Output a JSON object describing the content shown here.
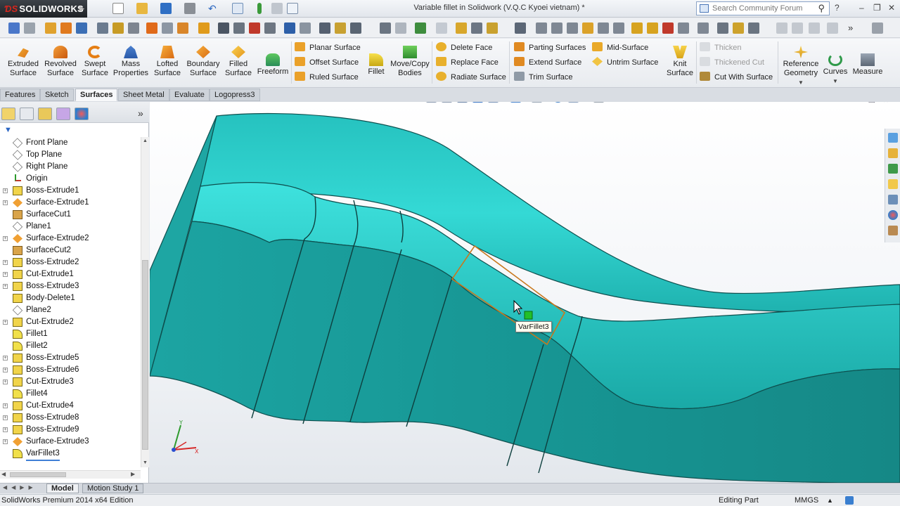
{
  "app": {
    "brand": "SOLIDWORKS",
    "window_title": "Variable fillet in Solidwork (V.Q.C Kyoei vietnam) *"
  },
  "search": {
    "placeholder": "Search Community Forum"
  },
  "ribbon": {
    "extruded_surface": "Extruded Surface",
    "revolved_surface": "Revolved Surface",
    "swept_surface": "Swept Surface",
    "mass_properties": "Mass Properties",
    "lofted_surface": "Lofted Surface",
    "boundary_surface": "Boundary Surface",
    "filled_surface": "Filled Surface",
    "freeform": "Freeform",
    "planar_surface": "Planar Surface",
    "offset_surface": "Offset Surface",
    "ruled_surface": "Ruled Surface",
    "fillet": "Fillet",
    "move_copy_bodies": "Move/Copy Bodies",
    "delete_face": "Delete Face",
    "replace_face": "Replace Face",
    "radiate_surface": "Radiate Surface",
    "parting_surfaces": "Parting Surfaces",
    "extend_surface": "Extend Surface",
    "trim_surface": "Trim Surface",
    "mid_surface": "Mid-Surface",
    "untrim_surface": "Untrim Surface",
    "knit_surface": "Knit Surface",
    "thicken": "Thicken",
    "thickened_cut": "Thickened Cut",
    "cut_with_surface": "Cut With Surface",
    "reference_geometry": "Reference Geometry",
    "curves": "Curves",
    "measure": "Measure"
  },
  "tabs": [
    "Features",
    "Sketch",
    "Surfaces",
    "Sheet Metal",
    "Evaluate",
    "Logopress3"
  ],
  "active_tab": "Surfaces",
  "tree": {
    "items": [
      {
        "label": "Front Plane",
        "icon": "plane-icon",
        "expandable": false
      },
      {
        "label": "Top Plane",
        "icon": "plane-icon",
        "expandable": false
      },
      {
        "label": "Right Plane",
        "icon": "plane-icon",
        "expandable": false
      },
      {
        "label": "Origin",
        "icon": "origin-icon",
        "expandable": false
      },
      {
        "label": "Boss-Extrude1",
        "icon": "boss-extrude-icon",
        "expandable": true
      },
      {
        "label": "Surface-Extrude1",
        "icon": "surface-extrude-icon",
        "expandable": true
      },
      {
        "label": "SurfaceCut1",
        "icon": "surface-cut-icon",
        "expandable": false
      },
      {
        "label": "Plane1",
        "icon": "plane-icon",
        "expandable": false
      },
      {
        "label": "Surface-Extrude2",
        "icon": "surface-extrude-icon",
        "expandable": true
      },
      {
        "label": "SurfaceCut2",
        "icon": "surface-cut-icon",
        "expandable": false
      },
      {
        "label": "Boss-Extrude2",
        "icon": "boss-extrude-icon",
        "expandable": true
      },
      {
        "label": "Cut-Extrude1",
        "icon": "cut-extrude-icon",
        "expandable": true
      },
      {
        "label": "Boss-Extrude3",
        "icon": "boss-extrude-icon",
        "expandable": true
      },
      {
        "label": "Body-Delete1",
        "icon": "body-delete-icon",
        "expandable": false
      },
      {
        "label": "Plane2",
        "icon": "plane-icon",
        "expandable": false
      },
      {
        "label": "Cut-Extrude2",
        "icon": "cut-extrude-icon",
        "expandable": true
      },
      {
        "label": "Fillet1",
        "icon": "fillet-icon",
        "expandable": false
      },
      {
        "label": "Fillet2",
        "icon": "fillet-icon",
        "expandable": false
      },
      {
        "label": "Boss-Extrude5",
        "icon": "boss-extrude-icon",
        "expandable": true
      },
      {
        "label": "Boss-Extrude6",
        "icon": "boss-extrude-icon",
        "expandable": true
      },
      {
        "label": "Cut-Extrude3",
        "icon": "cut-extrude-icon",
        "expandable": true
      },
      {
        "label": "Fillet4",
        "icon": "fillet-icon",
        "expandable": false
      },
      {
        "label": "Cut-Extrude4",
        "icon": "cut-extrude-icon",
        "expandable": true
      },
      {
        "label": "Boss-Extrude8",
        "icon": "boss-extrude-icon",
        "expandable": true
      },
      {
        "label": "Boss-Extrude9",
        "icon": "boss-extrude-icon",
        "expandable": true
      },
      {
        "label": "Surface-Extrude3",
        "icon": "surface-extrude-icon",
        "expandable": true
      },
      {
        "label": "VarFillet3",
        "icon": "variable-fillet-icon",
        "expandable": false,
        "selected": true
      }
    ]
  },
  "viewport": {
    "tooltip": "VarFillet3"
  },
  "bottom_tabs": [
    "Model",
    "Motion Study 1"
  ],
  "status": {
    "edition": "SolidWorks Premium 2014 x64 Edition",
    "mode": "Editing Part",
    "units": "MMGS"
  },
  "colors": {
    "part_body": "#1ea9a6",
    "part_highlight": "#3fe6e2",
    "selection_edge": "#c8781e",
    "tree_selection": "#3f7fd6"
  }
}
